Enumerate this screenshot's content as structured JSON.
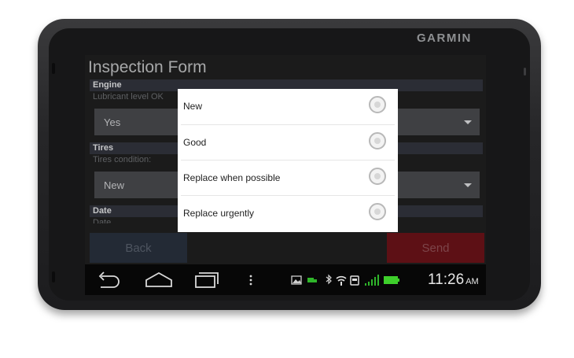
{
  "device": {
    "brand": "GARMIN"
  },
  "form": {
    "title": "Inspection Form",
    "sections": [
      {
        "header": "Engine",
        "question": "Lubricant level OK",
        "value": "Yes"
      },
      {
        "header": "Tires",
        "question": "Tires condition:",
        "value": "New"
      },
      {
        "header": "Date",
        "question": "Date"
      }
    ],
    "back_label": "Back",
    "send_label": "Send"
  },
  "dialog": {
    "options": [
      {
        "label": "New",
        "selected": false
      },
      {
        "label": "Good",
        "selected": false
      },
      {
        "label": "Replace when possible",
        "selected": false
      },
      {
        "label": "Replace urgently",
        "selected": false
      }
    ]
  },
  "navbar": {
    "buttons": [
      "back-icon",
      "home-icon",
      "recent-apps-icon",
      "menu-icon"
    ]
  },
  "status_bar": {
    "icons": [
      "image-notification-icon",
      "truck-icon",
      "bluetooth-icon",
      "wifi-icon",
      "card-icon",
      "signal-icon",
      "battery-icon"
    ],
    "time": "11:26",
    "ampm": "AM",
    "battery_color": "#3ecf2b",
    "signal_color": "#2fb52a"
  },
  "colors": {
    "send_button": "#5d1015",
    "back_button": "#232a35"
  }
}
